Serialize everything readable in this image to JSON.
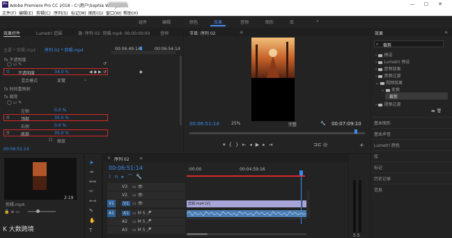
{
  "window": {
    "title": "Adobe Premiere Pro CC 2018 - C:\\用户\\Sophie Wong\\桌面\\",
    "logo": "Pr",
    "controls": [
      "—",
      "☐",
      "✕"
    ]
  },
  "menu": [
    "文件(F)",
    "编辑(E)",
    "剪辑(C)",
    "序列(S)",
    "标记(M)",
    "图形(G)",
    "窗口(W)",
    "帮助(H)"
  ],
  "workspaces": {
    "items": [
      "组件",
      "编辑",
      "颜色",
      "效果",
      "音频",
      "图形",
      "库"
    ],
    "active": "效果",
    "more": "»"
  },
  "effect_controls": {
    "tabs": [
      "效果控件",
      "Lumetri 范围",
      "源: 序列 02: 剪辑.mp4: 00:00:00:00",
      "音频"
    ],
    "source_row": "主要 * 剪辑.mp4",
    "sequence_row": "序列 02 * 剪辑.mp4",
    "time_start": "00:06:49:14",
    "time_end": "00:06:54:14",
    "opacity_section": "fx 不透明度",
    "opacity_label": "不透明度",
    "opacity_value": "34.0 %",
    "blend_label": "混合模式",
    "blend_value": "正常",
    "remap_section": "fx 时间重映射",
    "crop_section": "fx 裁剪",
    "left_label": "左侧",
    "left_value": "0.0 %",
    "top_label": "顶部",
    "top_value": "35.0 %",
    "right_label": "右侧",
    "right_value": "0.0 %",
    "bottom_label": "底部",
    "bottom_value": "35.0 %",
    "feather_label": "缩放",
    "timecode": "00:06:51:14"
  },
  "program": {
    "tab": "节目: 序列 02",
    "timecode": "00:06:51:14",
    "zoom": "25%",
    "quality": "完整",
    "duration": "00:07:09:10"
  },
  "effects_panel": {
    "title": "效果",
    "search_value": "裁剪",
    "tree": [
      "预设",
      "Lumetri 预设",
      "音频效果",
      "音频过渡",
      "视频效果",
      "变换",
      "裁剪",
      "视频过渡"
    ],
    "sections": [
      "基本图形",
      "基本声音",
      "Lumetri 颜色",
      "库",
      "标记",
      "历史记录",
      "信息"
    ]
  },
  "project": {
    "clip_name": "剪辑.mp4",
    "clip_duration": "2:19"
  },
  "timeline": {
    "tab": "序列 02",
    "timecode": "00:06:51:14",
    "ruler_start": ":00:00",
    "ruler_mid": "00:04:59:16",
    "v_tracks": [
      "V3",
      "V2",
      "V1"
    ],
    "a_tracks": [
      "A1",
      "A2",
      "A3"
    ],
    "clip_label": "剪辑.mp4 [V]",
    "watermark": "大数跨境"
  },
  "colors": {
    "accent": "#3b8ef0",
    "highlight": "#d8282a",
    "video_clip": "#a8a6d8",
    "audio_clip": "#4b7fb5"
  }
}
